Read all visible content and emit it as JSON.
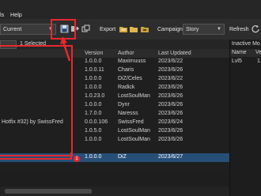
{
  "menu": {
    "items": [
      "ls",
      "Help"
    ]
  },
  "toolbar": {
    "profile_value": "Current",
    "export_label": "Export",
    "campaign_label": "Campaign",
    "campaign_value": "Story",
    "refresh_label": "Refresh"
  },
  "subbar": {
    "selected_text": "1 Selected"
  },
  "table": {
    "headers": [
      "Version",
      "Author",
      "Last Updated"
    ],
    "rows": [
      {
        "version": "1.0.0.0",
        "author": "Maximuuss",
        "date": "2023/6/22"
      },
      {
        "version": "1.0.0.11",
        "author": "Charis",
        "date": "2023/6/26"
      },
      {
        "version": "1.0.0.0",
        "author": "DiZ/Celes",
        "date": "2023/6/22"
      },
      {
        "version": "1.0.0.0",
        "author": "Radick",
        "date": "2023/6/26"
      },
      {
        "version": "1.0.23.0",
        "author": "LostSoulMan",
        "date": "2023/6/26"
      },
      {
        "version": "1.0.0.0",
        "author": "Dynr",
        "date": "2023/6/26"
      },
      {
        "version": "1.7.0.0",
        "author": "Naresss",
        "date": "2023/6/26"
      },
      {
        "version": "0.0.0.106",
        "author": "SwissFred",
        "date": "2023/6/24"
      },
      {
        "version": "1.0.5.0",
        "author": "LostSoulMan",
        "date": "2023/6/26"
      },
      {
        "version": "1.0.0.0",
        "author": "LostSoulMan",
        "date": "2023/6/26"
      },
      {
        "version": "1.0.0.0",
        "author": "DiZ",
        "date": "2023/6/27"
      }
    ],
    "partial_name": "Hotfix #32) by SwissFred"
  },
  "right_panel": {
    "title": "Inactive Mo",
    "headers": [
      "Name",
      "Ve"
    ],
    "row": {
      "name": "Lvl5",
      "ver": "1"
    }
  },
  "annotation": {
    "marker": "1"
  },
  "colors": {
    "highlight": "#e8282d",
    "selection": "#264f78"
  }
}
